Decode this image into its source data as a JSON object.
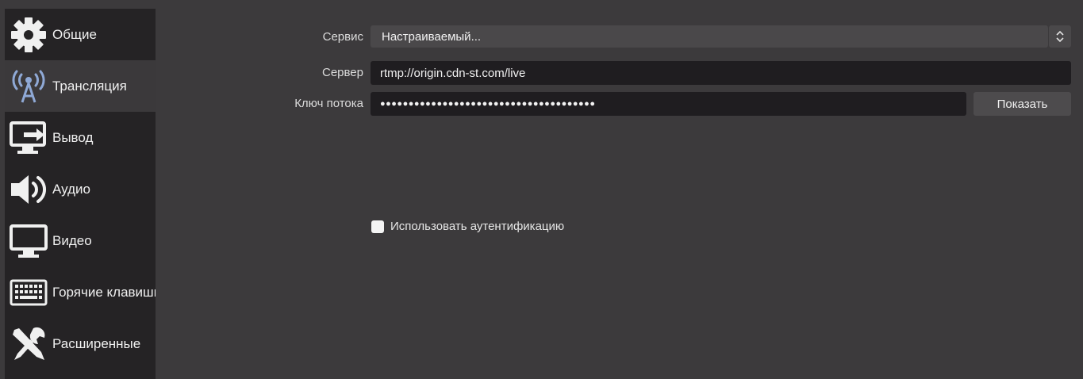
{
  "sidebar": {
    "items": [
      {
        "label": "Общие",
        "icon": "gear-icon"
      },
      {
        "label": "Трансляция",
        "icon": "broadcast-tower-icon"
      },
      {
        "label": "Вывод",
        "icon": "output-monitor-icon"
      },
      {
        "label": "Аудио",
        "icon": "speaker-icon"
      },
      {
        "label": "Видео",
        "icon": "monitor-icon"
      },
      {
        "label": "Горячие клавиши",
        "icon": "keyboard-icon"
      },
      {
        "label": "Расширенные",
        "icon": "wrench-screwdriver-icon"
      }
    ],
    "active_index": 1
  },
  "form": {
    "service_label": "Сервис",
    "service_value": "Настраиваемый...",
    "server_label": "Сервер",
    "server_value": "rtmp://origin.cdn-st.com/live",
    "key_label": "Ключ потока",
    "key_value": "●●●●●●●●●●●●●●●●●●●●●●●●●●●●●●●●●●●●●●",
    "show_button": "Показать",
    "auth_checkbox_label": "Использовать аутентификацию",
    "auth_checked": false
  },
  "colors": {
    "active_icon": "#8fa9d6",
    "icon": "#f0f0f0"
  }
}
